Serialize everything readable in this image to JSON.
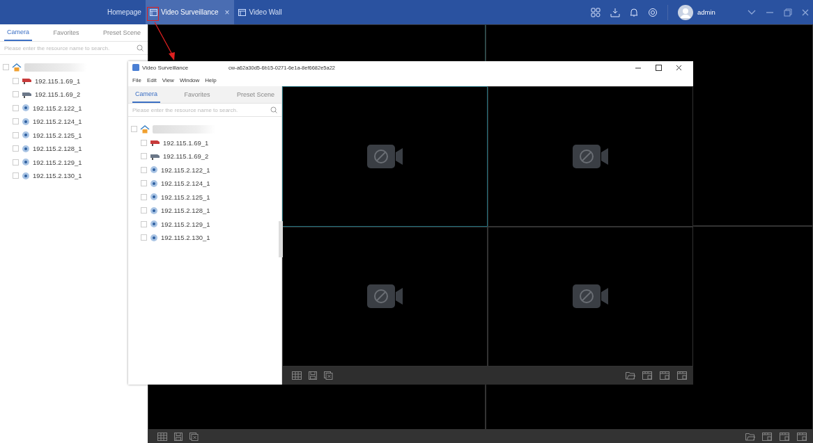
{
  "app_bar": {
    "tabs": [
      {
        "label": "Homepage",
        "selected": false,
        "kind": "text"
      },
      {
        "label": "Video Surveillance",
        "selected": true,
        "kind": "window",
        "close": "×"
      },
      {
        "label": "Video Wall",
        "selected": false,
        "kind": "wall"
      }
    ],
    "user": {
      "name": "admin"
    }
  },
  "resource_panel": {
    "tabs": [
      {
        "label": "Camera",
        "selected": true
      },
      {
        "label": "Favorites",
        "selected": false
      },
      {
        "label": "Preset Scene",
        "selected": false
      }
    ],
    "search": {
      "placeholder": "Please enter the resource name to search."
    },
    "tree": {
      "checked": false,
      "children": [
        {
          "label": "192.115.1.69_1",
          "kind": "alarm",
          "checked": false
        },
        {
          "label": "192.115.1.69_2",
          "kind": "bullet",
          "checked": false
        },
        {
          "label": "192.115.2.122_1",
          "kind": "dome",
          "checked": false
        },
        {
          "label": "192.115.2.124_1",
          "kind": "dome",
          "checked": false
        },
        {
          "label": "192.115.2.125_1",
          "kind": "dome",
          "checked": false
        },
        {
          "label": "192.115.2.128_1",
          "kind": "dome",
          "checked": false
        },
        {
          "label": "192.115.2.129_1",
          "kind": "dome",
          "checked": false
        },
        {
          "label": "192.115.2.130_1",
          "kind": "dome",
          "checked": false
        }
      ]
    }
  },
  "popup_window": {
    "title": "Video Surveillance",
    "id": "cw-a62a30d5-6b15-0271-6e1a-8ef6682e5a22",
    "menu": [
      "File",
      "Edit",
      "View",
      "Window",
      "Help"
    ],
    "resource_panel": {
      "tabs": [
        {
          "label": "Camera",
          "selected": true
        },
        {
          "label": "Favorites",
          "selected": false
        },
        {
          "label": "Preset Scene",
          "selected": false
        }
      ],
      "search": {
        "placeholder": "Please enter the resource name to search."
      },
      "tree": {
        "checked": false,
        "children": [
          {
            "label": "192.115.1.69_1",
            "kind": "alarm",
            "checked": false
          },
          {
            "label": "192.115.1.69_2",
            "kind": "bullet",
            "checked": false
          },
          {
            "label": "192.115.2.122_1",
            "kind": "dome",
            "checked": false
          },
          {
            "label": "192.115.2.124_1",
            "kind": "dome",
            "checked": false
          },
          {
            "label": "192.115.2.125_1",
            "kind": "dome",
            "checked": false
          },
          {
            "label": "192.115.2.128_1",
            "kind": "dome",
            "checked": false
          },
          {
            "label": "192.115.2.129_1",
            "kind": "dome",
            "checked": false
          },
          {
            "label": "192.115.2.130_1",
            "kind": "dome",
            "checked": false
          }
        ]
      }
    },
    "tiles": [
      {
        "kind": "empty"
      },
      {
        "kind": "empty"
      },
      {
        "kind": "empty"
      },
      {
        "kind": "empty"
      }
    ]
  }
}
